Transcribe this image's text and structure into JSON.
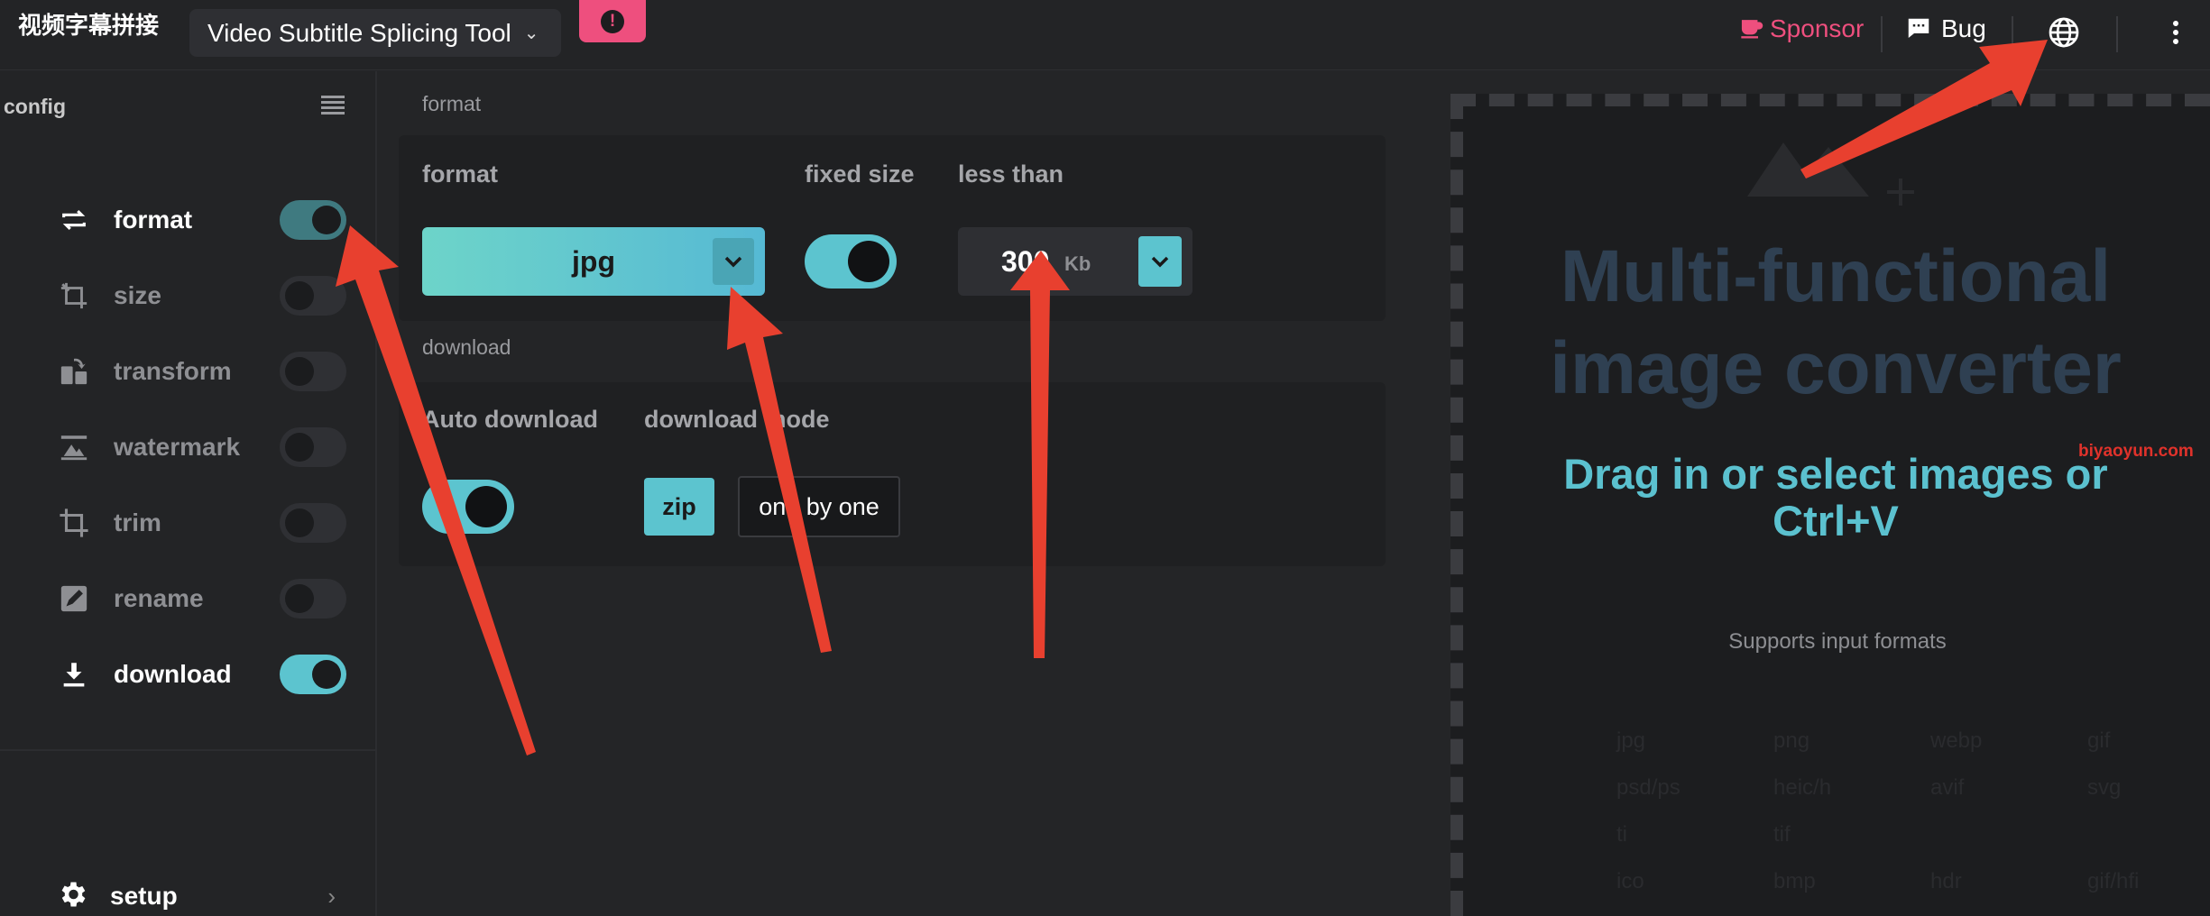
{
  "header": {
    "app_title": "视频字幕拼接",
    "tool_select": "Video Subtitle Splicing Tool",
    "alert_icon": "exclamation-icon",
    "sponsor": "Sponsor",
    "bug": "Bug"
  },
  "sidebar": {
    "title": "config",
    "items": [
      {
        "label": "format",
        "on": true
      },
      {
        "label": "size",
        "on": false
      },
      {
        "label": "transform",
        "on": false
      },
      {
        "label": "watermark",
        "on": false
      },
      {
        "label": "trim",
        "on": false
      },
      {
        "label": "rename",
        "on": false
      },
      {
        "label": "download",
        "on": true
      }
    ],
    "setup": "setup"
  },
  "format_section": {
    "title": "format",
    "format_label": "format",
    "format_value": "jpg",
    "fixed_size_label": "fixed size",
    "fixed_size_on": true,
    "less_than_label": "less than",
    "size_value": "300",
    "size_unit": "Kb"
  },
  "download_section": {
    "title": "download",
    "auto_label": "Auto download",
    "auto_on": true,
    "mode_label": "download mode",
    "zip": "zip",
    "one_by_one": "one by one"
  },
  "dropzone": {
    "headline_1": "Multi-functional",
    "headline_2": "image converter",
    "subline": "Drag in or select images or Ctrl+V",
    "watermark": "biyaoyun.com",
    "support": "Supports input formats",
    "formats": [
      "jpg",
      "png",
      "webp",
      "gif",
      "psd/ps",
      "heic/h",
      "avif",
      "svg",
      "ti",
      "tif",
      "ico",
      "bmp",
      "hdr",
      "gif/hfi"
    ]
  },
  "colors": {
    "accent": "#5cc4cf",
    "sponsor": "#ee4f7e",
    "annotation_arrow": "#e8402f"
  }
}
